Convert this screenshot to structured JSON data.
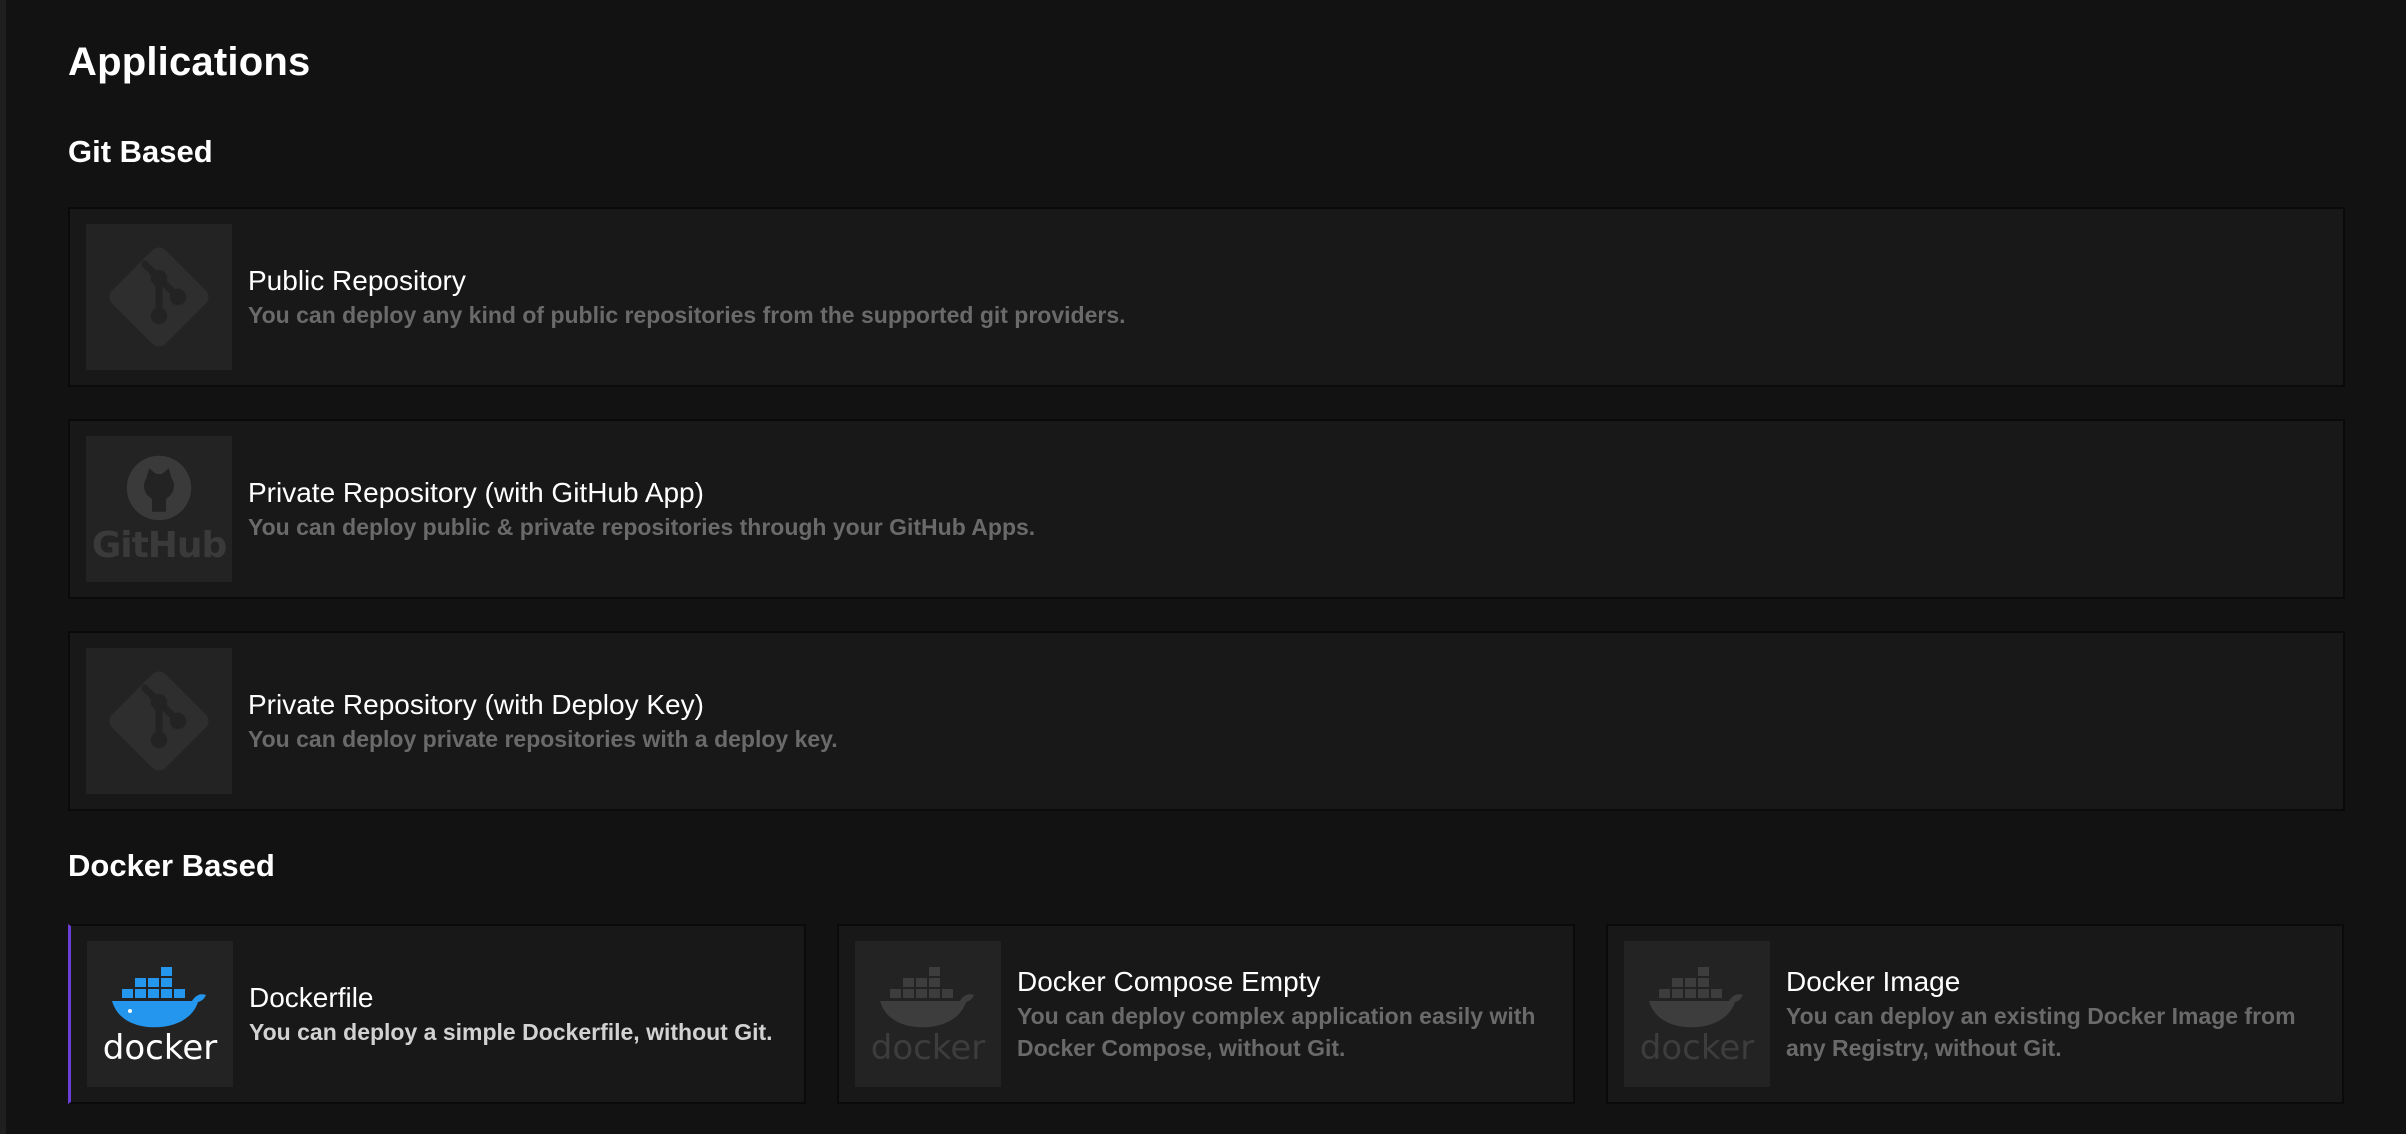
{
  "page": {
    "title": "Applications"
  },
  "sections": {
    "git": {
      "title": "Git Based"
    },
    "docker": {
      "title": "Docker Based"
    }
  },
  "git_cards": [
    {
      "title": "Public Repository",
      "description": "You can deploy any kind of public repositories from the supported git providers.",
      "icon": "git-icon"
    },
    {
      "title": "Private Repository (with GitHub App)",
      "description": "You can deploy public & private repositories through your GitHub Apps.",
      "icon": "github-icon"
    },
    {
      "title": "Private Repository (with Deploy Key)",
      "description": "You can deploy private repositories with a deploy key.",
      "icon": "git-icon"
    }
  ],
  "docker_cards": [
    {
      "title": "Dockerfile",
      "description": "You can deploy a simple Dockerfile, without Git.",
      "icon": "docker-icon",
      "selected": true
    },
    {
      "title": "Docker Compose Empty",
      "description": "You can deploy complex application easily with Docker Compose, without Git.",
      "icon": "docker-icon",
      "selected": false
    },
    {
      "title": "Docker Image",
      "description": "You can deploy an existing Docker Image from any Registry, without Git.",
      "icon": "docker-icon",
      "selected": false
    }
  ],
  "icons": {
    "docker_logo_text": "docker",
    "github_logo_text": "GitHub"
  },
  "colors": {
    "background": "#121212",
    "card": "#181818",
    "accent": "#6b3fd6",
    "docker_blue": "#2496ed"
  }
}
